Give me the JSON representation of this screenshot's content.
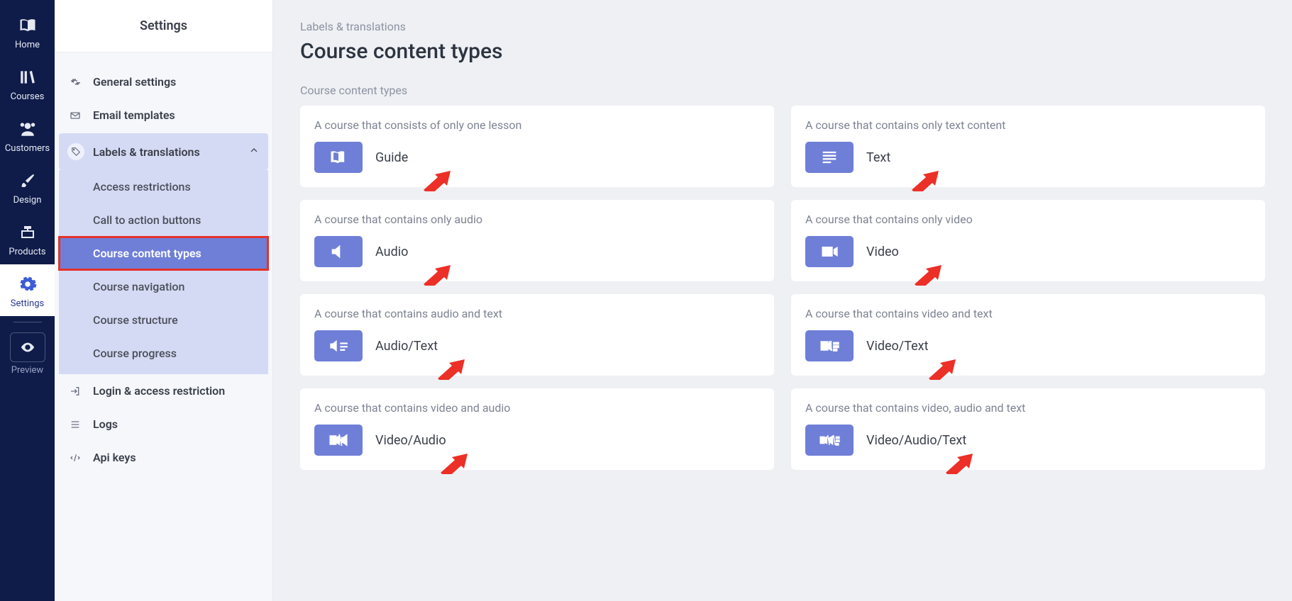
{
  "rail": {
    "items": [
      {
        "name": "home",
        "label": "Home"
      },
      {
        "name": "courses",
        "label": "Courses"
      },
      {
        "name": "customers",
        "label": "Customers"
      },
      {
        "name": "design",
        "label": "Design"
      },
      {
        "name": "products",
        "label": "Products"
      },
      {
        "name": "settings",
        "label": "Settings"
      },
      {
        "name": "preview",
        "label": "Preview"
      }
    ]
  },
  "panel": {
    "title": "Settings",
    "menu": {
      "general": "General settings",
      "email": "Email templates",
      "labels_group": "Labels & translations",
      "login": "Login & access restriction",
      "logs": "Logs",
      "api": "Api keys"
    },
    "labels_sub": [
      "Access restrictions",
      "Call to action buttons",
      "Course content types",
      "Course navigation",
      "Course structure",
      "Course progress"
    ]
  },
  "main": {
    "crumb": "Labels & translations",
    "title": "Course content types",
    "section": "Course content types",
    "cards": [
      {
        "desc": "A course that consists of only one lesson",
        "label": "Guide",
        "icon": "book"
      },
      {
        "desc": "A course that contains only text content",
        "label": "Text",
        "icon": "text"
      },
      {
        "desc": "A course that contains only audio",
        "label": "Audio",
        "icon": "speaker"
      },
      {
        "desc": "A course that contains only video",
        "label": "Video",
        "icon": "video"
      },
      {
        "desc": "A course that contains audio and text",
        "label": "Audio/Text",
        "icon": "speaker-text"
      },
      {
        "desc": "A course that contains video and text",
        "label": "Video/Text",
        "icon": "video-text"
      },
      {
        "desc": "A course that contains video and audio",
        "label": "Video/Audio",
        "icon": "video-audio"
      },
      {
        "desc": "A course that contains video, audio and text",
        "label": "Video/Audio/Text",
        "icon": "video-audio-text"
      }
    ]
  }
}
